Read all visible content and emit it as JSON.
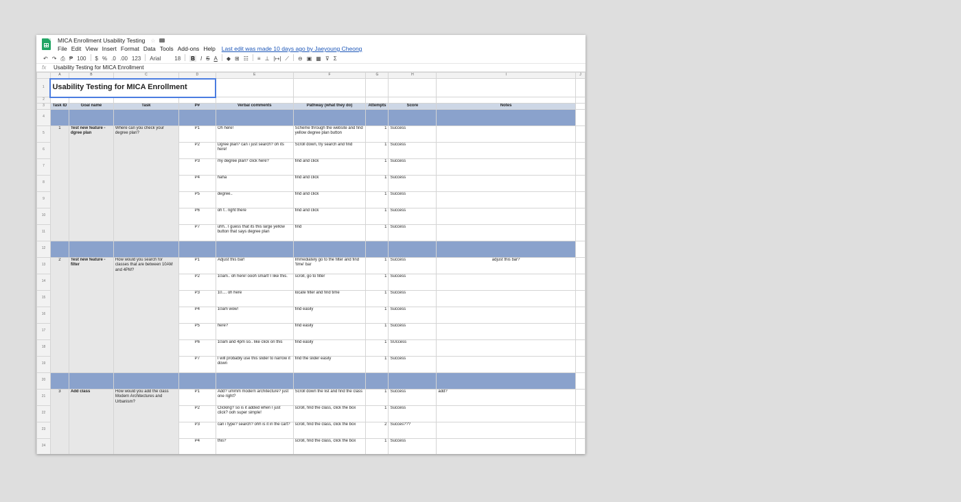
{
  "doc": {
    "title": "MICA Enrollment Usability Testing",
    "star": "☆",
    "last_edit": "Last edit was made 10 days ago by Jaeyoung Cheong"
  },
  "menu": [
    "File",
    "Edit",
    "View",
    "Insert",
    "Format",
    "Data",
    "Tools",
    "Add-ons",
    "Help"
  ],
  "toolbar": {
    "undo": "↶",
    "redo": "↷",
    "print": "⎙",
    "paint": "₱",
    "zoom": "100",
    "currency": "$",
    "percent": "%",
    "dec_less": ".0",
    "dec_more": ".00",
    "format": "123",
    "font": "Arial",
    "size": "18",
    "bold": "B",
    "italic": "I",
    "strike": "S",
    "textcolor": "A",
    "fill": "◆",
    "borders": "⊞",
    "merge": "☷",
    "halign": "≡",
    "valign": "⊥",
    "wrap": "|↦|",
    "rotate": "⟋",
    "link": "⊖",
    "comment": "▣",
    "chart": "▦",
    "filter": "⊽",
    "functions": "Σ"
  },
  "formula": {
    "label": "fx",
    "value": "Usability Testing for MICA Enrollment"
  },
  "columns": [
    "A",
    "B",
    "C",
    "D",
    "E",
    "F",
    "G",
    "H",
    "I",
    "J"
  ],
  "sheet_title": "Usability Testing for MICA Enrollment",
  "headers": [
    "Task ID",
    "Goal name",
    "Task",
    "P#",
    "Verbal comments",
    "Pathway (what they do)",
    "Attempts",
    "Score",
    "Notes"
  ],
  "groups": [
    {
      "id": "1",
      "goal": "Test new feature - dgree plan",
      "task": "Where can you check your degree plan?",
      "rows": [
        {
          "p": "P1",
          "comment": "Oh here!",
          "path": "Scheme through the website and find yellow degree plan button",
          "attempts": "1",
          "score": "Success",
          "notes": ""
        },
        {
          "p": "P2",
          "comment": "Dgree plan? can i just search? oh its here!",
          "path": "Scroll down, try search and find",
          "attempts": "1",
          "score": "Success",
          "notes": ""
        },
        {
          "p": "P3",
          "comment": "my degree plan? click here?",
          "path": "find and click",
          "attempts": "1",
          "score": "Success",
          "notes": ""
        },
        {
          "p": "P4",
          "comment": "haha",
          "path": "find and click",
          "attempts": "1",
          "score": "Success",
          "notes": ""
        },
        {
          "p": "P5",
          "comment": "degree..",
          "path": "find and click",
          "attempts": "1",
          "score": "Success",
          "notes": ""
        },
        {
          "p": "P6",
          "comment": "oh f.. right there",
          "path": "find and click",
          "attempts": "1",
          "score": "Success",
          "notes": ""
        },
        {
          "p": "P7",
          "comment": "uhh.. I guess that its this large yellow button that says degree plan",
          "path": "find",
          "attempts": "1",
          "score": "Success",
          "notes": ""
        }
      ]
    },
    {
      "id": "2",
      "goal": "Test new feature - filter",
      "task": "How would you search for classes that are between 10AM and 4PM?",
      "rows": [
        {
          "p": "P1",
          "comment": "Adjust this bar!",
          "path": "Immediately go to the filter and find 'time' bar",
          "attempts": "1",
          "score": "Success",
          "notes": "adjust this bar?"
        },
        {
          "p": "P2",
          "comment": "10am.. oh here! oooh smart! I like this.",
          "path": "scroll, go to filter",
          "attempts": "1",
          "score": "Success",
          "notes": ""
        },
        {
          "p": "P3",
          "comment": "10.... oh here",
          "path": "locate filter and find time",
          "attempts": "1",
          "score": "Success",
          "notes": ""
        },
        {
          "p": "P4",
          "comment": "10am wow!",
          "path": "find easily",
          "attempts": "1",
          "score": "Success",
          "notes": ""
        },
        {
          "p": "P5",
          "comment": "here?",
          "path": "find easily",
          "attempts": "1",
          "score": "Success",
          "notes": ""
        },
        {
          "p": "P6",
          "comment": "10am and 4pm so.. like click on this",
          "path": "find easily",
          "attempts": "1",
          "score": "SUccess",
          "notes": ""
        },
        {
          "p": "P7",
          "comment": "I will probably use this slider to narrow it down",
          "path": "find the slider easily",
          "attempts": "1",
          "score": "Success",
          "notes": ""
        }
      ]
    },
    {
      "id": "3",
      "goal": "Add class",
      "task": "How would you add the class Modern Architectures and Urbanism?",
      "rows": [
        {
          "p": "P1",
          "comment": "Add? ummm modern architecture? just one right?",
          "path": "Scroll down the list and find the class",
          "attempts": "1",
          "score": "Success",
          "notes": "add?"
        },
        {
          "p": "P2",
          "comment": "Clicking? so is it added when I just click? ooh super simple!",
          "path": "scroll, find the class, click the box",
          "attempts": "1",
          "score": "Success",
          "notes": ""
        },
        {
          "p": "P3",
          "comment": "can i type? search? ohh is it in the cart?",
          "path": "scroll, find the class, click the box",
          "attempts": "2",
          "score": "Succes???",
          "notes": ""
        },
        {
          "p": "P4",
          "comment": "this?",
          "path": "scroll, find the class, click the box",
          "attempts": "1",
          "score": "Success",
          "notes": ""
        }
      ]
    }
  ]
}
